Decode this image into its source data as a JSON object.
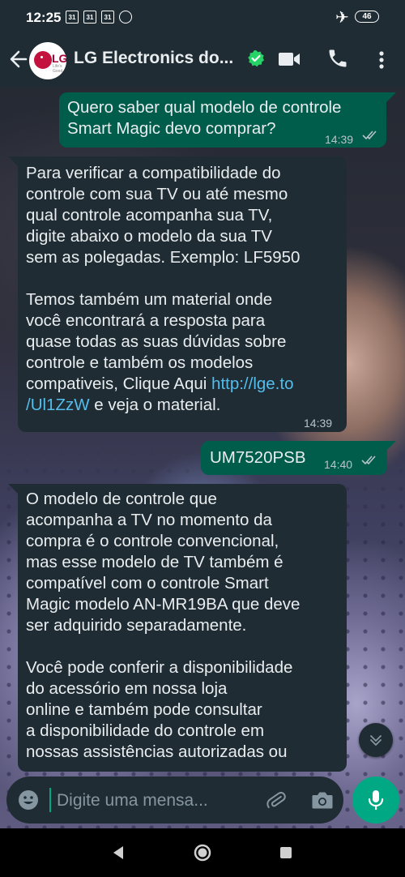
{
  "status_bar": {
    "time": "12:25",
    "calendar_badges": [
      "31",
      "31",
      "31"
    ],
    "battery": "46"
  },
  "header": {
    "title": "LG Electronics do...",
    "avatar_text": "LG",
    "avatar_subtext": "Life's Good",
    "verified_color": "#25d366"
  },
  "messages": [
    {
      "direction": "outgoing",
      "text": "Quero saber qual modelo de controle\nSmart Magic devo comprar?",
      "time": "14:39"
    },
    {
      "direction": "incoming",
      "text": "Para verificar a compatibilidade do\ncontrole com sua TV ou até mesmo\nqual controle acompanha sua TV,\ndigite abaixo o modelo da sua TV\nsem as polegadas. Exemplo: LF5950\n\nTemos também um material onde\nvocê encontrará a resposta para\nquase todas as suas dúvidas sobre\ncontrole e também os modelos\ncompativeis, Clique Aqui ",
      "link": "http://lge.to\n/Ul1ZzW",
      "text_after_link": "  e veja o material.",
      "time": "14:39"
    },
    {
      "direction": "outgoing",
      "text": "UM7520PSB",
      "time": "14:40"
    },
    {
      "direction": "incoming",
      "text": "O modelo de controle que\nacompanha a TV no momento da\ncompra é o controle convencional,\nmas esse modelo de TV também é\ncompatível com o controle Smart\nMagic modelo AN-MR19BA que deve\nser adquirido separadamente.\n\n Você pode conferir a disponibilidade\ndo acessório em nossa loja\nonline e também pode consultar\na disponibilidade do controle em\nnossas assistências autorizadas ou"
    }
  ],
  "composer": {
    "placeholder": "Digite uma mensa..."
  },
  "colors": {
    "outgoing_bubble": "#005c4b",
    "incoming_bubble": "#1f2c34",
    "accent": "#00a884",
    "link": "#53bdeb",
    "read_checks": "#53bdeb"
  },
  "icons": [
    "back-arrow-icon",
    "verified-badge-icon",
    "video-call-icon",
    "phone-icon",
    "more-options-icon",
    "scroll-down-icon",
    "emoji-icon",
    "attach-icon",
    "camera-icon",
    "mic-icon",
    "nav-back-icon",
    "nav-home-icon",
    "nav-recents-icon"
  ]
}
